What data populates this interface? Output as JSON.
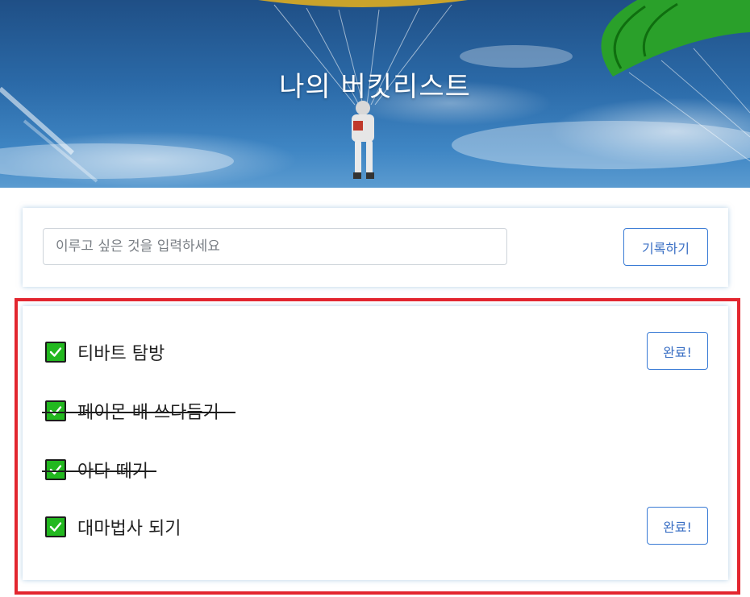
{
  "header": {
    "title": "나의 버킷리스트"
  },
  "form": {
    "placeholder": "이루고 싶은 것을 입력하세요",
    "value": "",
    "submit_label": "기록하기"
  },
  "bucket_list": {
    "items": [
      {
        "text": "티바트 탐방",
        "completed": false,
        "action_label": "완료!"
      },
      {
        "text": "페이몬 배 쓰다듬기",
        "completed": true
      },
      {
        "text": "아다 떼기",
        "completed": true
      },
      {
        "text": "대마법사 되기",
        "completed": false,
        "action_label": "완료!"
      }
    ]
  },
  "colors": {
    "checkbox": "#22b81f",
    "button_border": "#3a7bd5",
    "highlight_border": "#e3262f"
  },
  "icons": {
    "checkbox": "check-icon"
  }
}
